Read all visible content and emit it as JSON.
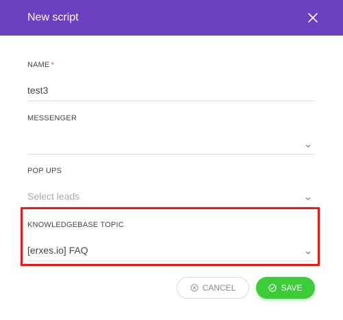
{
  "modal": {
    "title": "New script",
    "header_color": "#6d3fc1"
  },
  "fields": {
    "name": {
      "label": "NAME",
      "required_mark": "*",
      "value": "test3"
    },
    "messenger": {
      "label": "MESSENGER",
      "value": ""
    },
    "popups": {
      "label": "POP UPS",
      "placeholder": "Select leads"
    },
    "knowledgebase": {
      "label": "KNOWLEDGEBASE TOPIC",
      "value": "[erxes.io] FAQ"
    }
  },
  "buttons": {
    "cancel": {
      "label": "CANCEL",
      "icon": "cancel-circle-icon"
    },
    "save": {
      "label": "SAVE",
      "icon": "check-circle-icon",
      "color": "#3ccc38"
    }
  },
  "annotation": {
    "highlight_color": "#e8191b"
  }
}
